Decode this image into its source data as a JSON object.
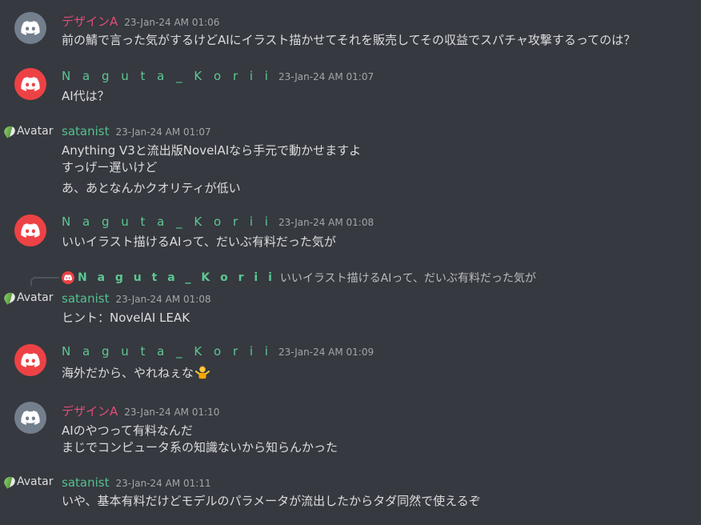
{
  "messages": [
    {
      "author": "デザインA",
      "time": "23-Jan-24 AM 01:06",
      "lines": [
        "前の鯖で言った気がするけどAIにイラスト描かせてそれを販売してその収益でスパチャ攻撃するってのは？"
      ]
    },
    {
      "author": "N a g u t a _ K o r i i",
      "time": "23-Jan-24 AM 01:07",
      "lines": [
        "AI代は？"
      ]
    },
    {
      "author": "satanist",
      "avatar_alt": "Avatar",
      "time": "23-Jan-24 AM 01:07",
      "lines": [
        "Anything V3と流出版NovelAIなら手元で動かせますよ",
        "すっげー遅いけど",
        "あ、あとなんかクオリティが低い"
      ]
    },
    {
      "author": "N a g u t a _ K o r i i",
      "time": "23-Jan-24 AM 01:08",
      "lines": [
        "いいイラスト描けるAIって、だいぶ有料だった気が"
      ]
    },
    {
      "reply": {
        "author": "N a g u t a _ K o r i i",
        "text": "いいイラスト描けるAIって、だいぶ有料だった気が"
      },
      "author": "satanist",
      "avatar_alt": "Avatar",
      "time": "23-Jan-24 AM 01:08",
      "lines": [
        "ヒント：NovelAI LEAK"
      ]
    },
    {
      "author": "N a g u t a _ K o r i i",
      "time": "23-Jan-24 AM 01:09",
      "lines": [
        "海外だから、やれねぇな"
      ],
      "emoji": "person-shrugging"
    },
    {
      "author": "デザインA",
      "time": "23-Jan-24 AM 01:10",
      "lines": [
        "AIのやつって有料なんだ",
        "まじでコンピュータ系の知識ないから知らんかった"
      ]
    },
    {
      "author": "satanist",
      "avatar_alt": "Avatar",
      "time": "23-Jan-24 AM 01:11",
      "lines": [
        "いや、基本有料だけどモデルのパラメータが流出したからタダ同然で使えるぞ"
      ]
    }
  ],
  "colors": {
    "background": "#36393f",
    "design_name": "#e24e78",
    "naguta_name": "#5dc794",
    "satanist_name": "#53c08e",
    "avatar_grey": "#747f8d",
    "avatar_red": "#ed4245"
  }
}
